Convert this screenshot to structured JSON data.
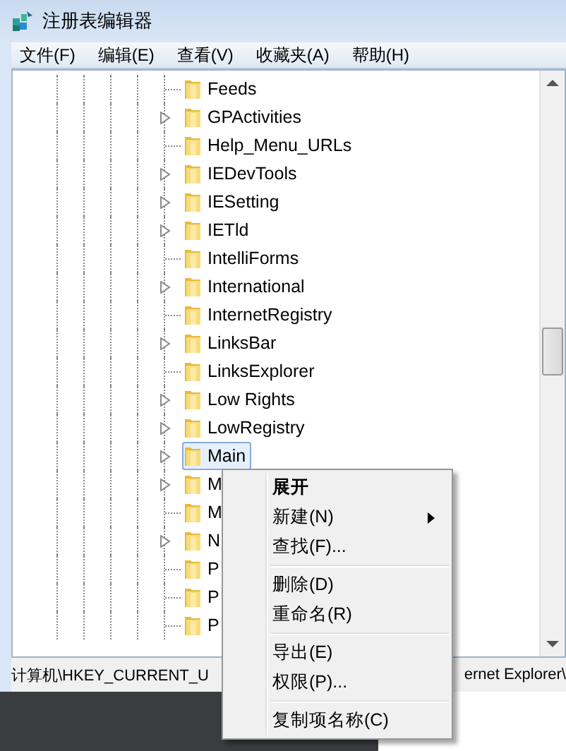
{
  "window": {
    "title": "注册表编辑器"
  },
  "menu_bar": [
    "文件(F)",
    "编辑(E)",
    "查看(V)",
    "收藏夹(A)",
    "帮助(H)"
  ],
  "tree": {
    "items": [
      {
        "label": "Feeds",
        "expandable": false,
        "selected": false
      },
      {
        "label": "GPActivities",
        "expandable": true,
        "selected": false
      },
      {
        "label": "Help_Menu_URLs",
        "expandable": false,
        "selected": false
      },
      {
        "label": "IEDevTools",
        "expandable": true,
        "selected": false
      },
      {
        "label": "IESetting",
        "expandable": true,
        "selected": false
      },
      {
        "label": "IETld",
        "expandable": true,
        "selected": false
      },
      {
        "label": "IntelliForms",
        "expandable": false,
        "selected": false
      },
      {
        "label": "International",
        "expandable": true,
        "selected": false
      },
      {
        "label": "InternetRegistry",
        "expandable": false,
        "selected": false
      },
      {
        "label": "LinksBar",
        "expandable": true,
        "selected": false
      },
      {
        "label": "LinksExplorer",
        "expandable": false,
        "selected": false
      },
      {
        "label": "Low Rights",
        "expandable": true,
        "selected": false
      },
      {
        "label": "LowRegistry",
        "expandable": true,
        "selected": false
      },
      {
        "label": "Main",
        "expandable": true,
        "selected": true
      },
      {
        "label": "M",
        "expandable": true,
        "selected": false
      },
      {
        "label": "M",
        "expandable": false,
        "selected": false
      },
      {
        "label": "N",
        "expandable": true,
        "selected": false
      },
      {
        "label": "P",
        "expandable": false,
        "selected": false
      },
      {
        "label": "P",
        "expandable": false,
        "selected": false
      },
      {
        "label": "P",
        "expandable": false,
        "selected": false
      }
    ]
  },
  "status_bar": {
    "path_start": "计算机\\HKEY_CURRENT_U",
    "path_end": "ernet Explorer\\"
  },
  "context_menu": {
    "items": [
      {
        "kind": "item",
        "label": "展开",
        "default": true,
        "submenu": false
      },
      {
        "kind": "item",
        "label": "新建(N)",
        "default": false,
        "submenu": true
      },
      {
        "kind": "item",
        "label": "查找(F)...",
        "default": false,
        "submenu": false
      },
      {
        "kind": "separator"
      },
      {
        "kind": "item",
        "label": "删除(D)",
        "default": false,
        "submenu": false
      },
      {
        "kind": "item",
        "label": "重命名(R)",
        "default": false,
        "submenu": false
      },
      {
        "kind": "separator"
      },
      {
        "kind": "item",
        "label": "导出(E)",
        "default": false,
        "submenu": false
      },
      {
        "kind": "item",
        "label": "权限(P)...",
        "default": false,
        "submenu": false
      },
      {
        "kind": "separator"
      },
      {
        "kind": "item",
        "label": "复制项名称(C)",
        "default": false,
        "submenu": false
      }
    ]
  }
}
